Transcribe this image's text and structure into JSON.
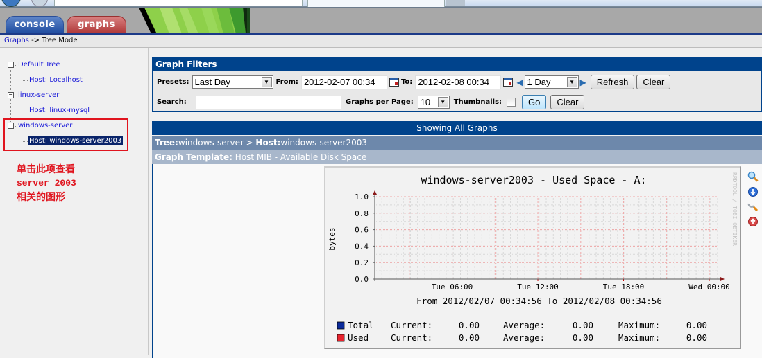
{
  "header": {
    "tabs": [
      {
        "label": "console",
        "color": "#1f4ca0"
      },
      {
        "label": "graphs",
        "color": "#b03838"
      }
    ]
  },
  "breadcrumb": {
    "link": "Graphs",
    "separator": " -> ",
    "current": "Tree Mode"
  },
  "sidebar": {
    "trees": [
      {
        "label": "Default Tree",
        "hosts": [
          "Host: Localhost"
        ]
      },
      {
        "label": "linux-server",
        "hosts": [
          "Host: linux-mysql"
        ]
      },
      {
        "label": "windows-server",
        "hosts": [
          "Host: windows-server2003"
        ]
      }
    ],
    "selected_host": "Host: windows-server2003",
    "annotation": {
      "line1": "单击此项查看",
      "line2": "server 2003",
      "line3": "相关的图形",
      "color": "#e0141e"
    }
  },
  "filters": {
    "title": "Graph Filters",
    "presets_label": "Presets:",
    "presets_value": "Last Day",
    "from_label": "From:",
    "from_value": "2012-02-07 00:34",
    "to_label": "To:",
    "to_value": "2012-02-08 00:34",
    "timespan_value": "1 Day",
    "refresh_label": "Refresh",
    "clear_label": "Clear",
    "search_label": "Search:",
    "search_value": "",
    "graphs_per_page_label": "Graphs per Page:",
    "graphs_per_page_value": "10",
    "thumbnails_label": "Thumbnails:",
    "thumbnails_checked": false,
    "go_label": "Go",
    "clear2_label": "Clear"
  },
  "results": {
    "showing": "Showing All Graphs",
    "tree_label": "Tree:",
    "tree_value": "windows-server-> ",
    "host_label": "Host:",
    "host_value": "windows-server2003",
    "template_label": "Graph Template:",
    "template_value": " Host MIB - Available Disk Space"
  },
  "chart_data": {
    "type": "line",
    "title": "windows-server2003 - Used Space - A:",
    "ylabel": "bytes",
    "xlabel": "",
    "ylim": [
      0,
      1.0
    ],
    "yticks": [
      "0.0",
      "0.2",
      "0.4",
      "0.6",
      "0.8",
      "1.0"
    ],
    "xticks": [
      "Tue 06:00",
      "Tue 12:00",
      "Tue 18:00",
      "Wed 00:00"
    ],
    "period": "From 2012/02/07 00:34:56 To 2012/02/08 00:34:56",
    "watermark": "RRDTOOL / TOBI OETIKER",
    "grid": true,
    "series": [
      {
        "name": "Total",
        "color": "#0a2a9a",
        "current": "0.00",
        "average": "0.00",
        "maximum": "0.00",
        "values": []
      },
      {
        "name": "Used",
        "color": "#e8242e",
        "current": "0.00",
        "average": "0.00",
        "maximum": "0.00",
        "values": []
      }
    ],
    "legend_labels": {
      "current": "Current:",
      "average": "Average:",
      "maximum": "Maximum:"
    }
  },
  "graph_actions": [
    {
      "icon": "zoom-icon"
    },
    {
      "icon": "export-down-icon"
    },
    {
      "icon": "properties-wrench-icon"
    },
    {
      "icon": "page-top-icon"
    }
  ]
}
